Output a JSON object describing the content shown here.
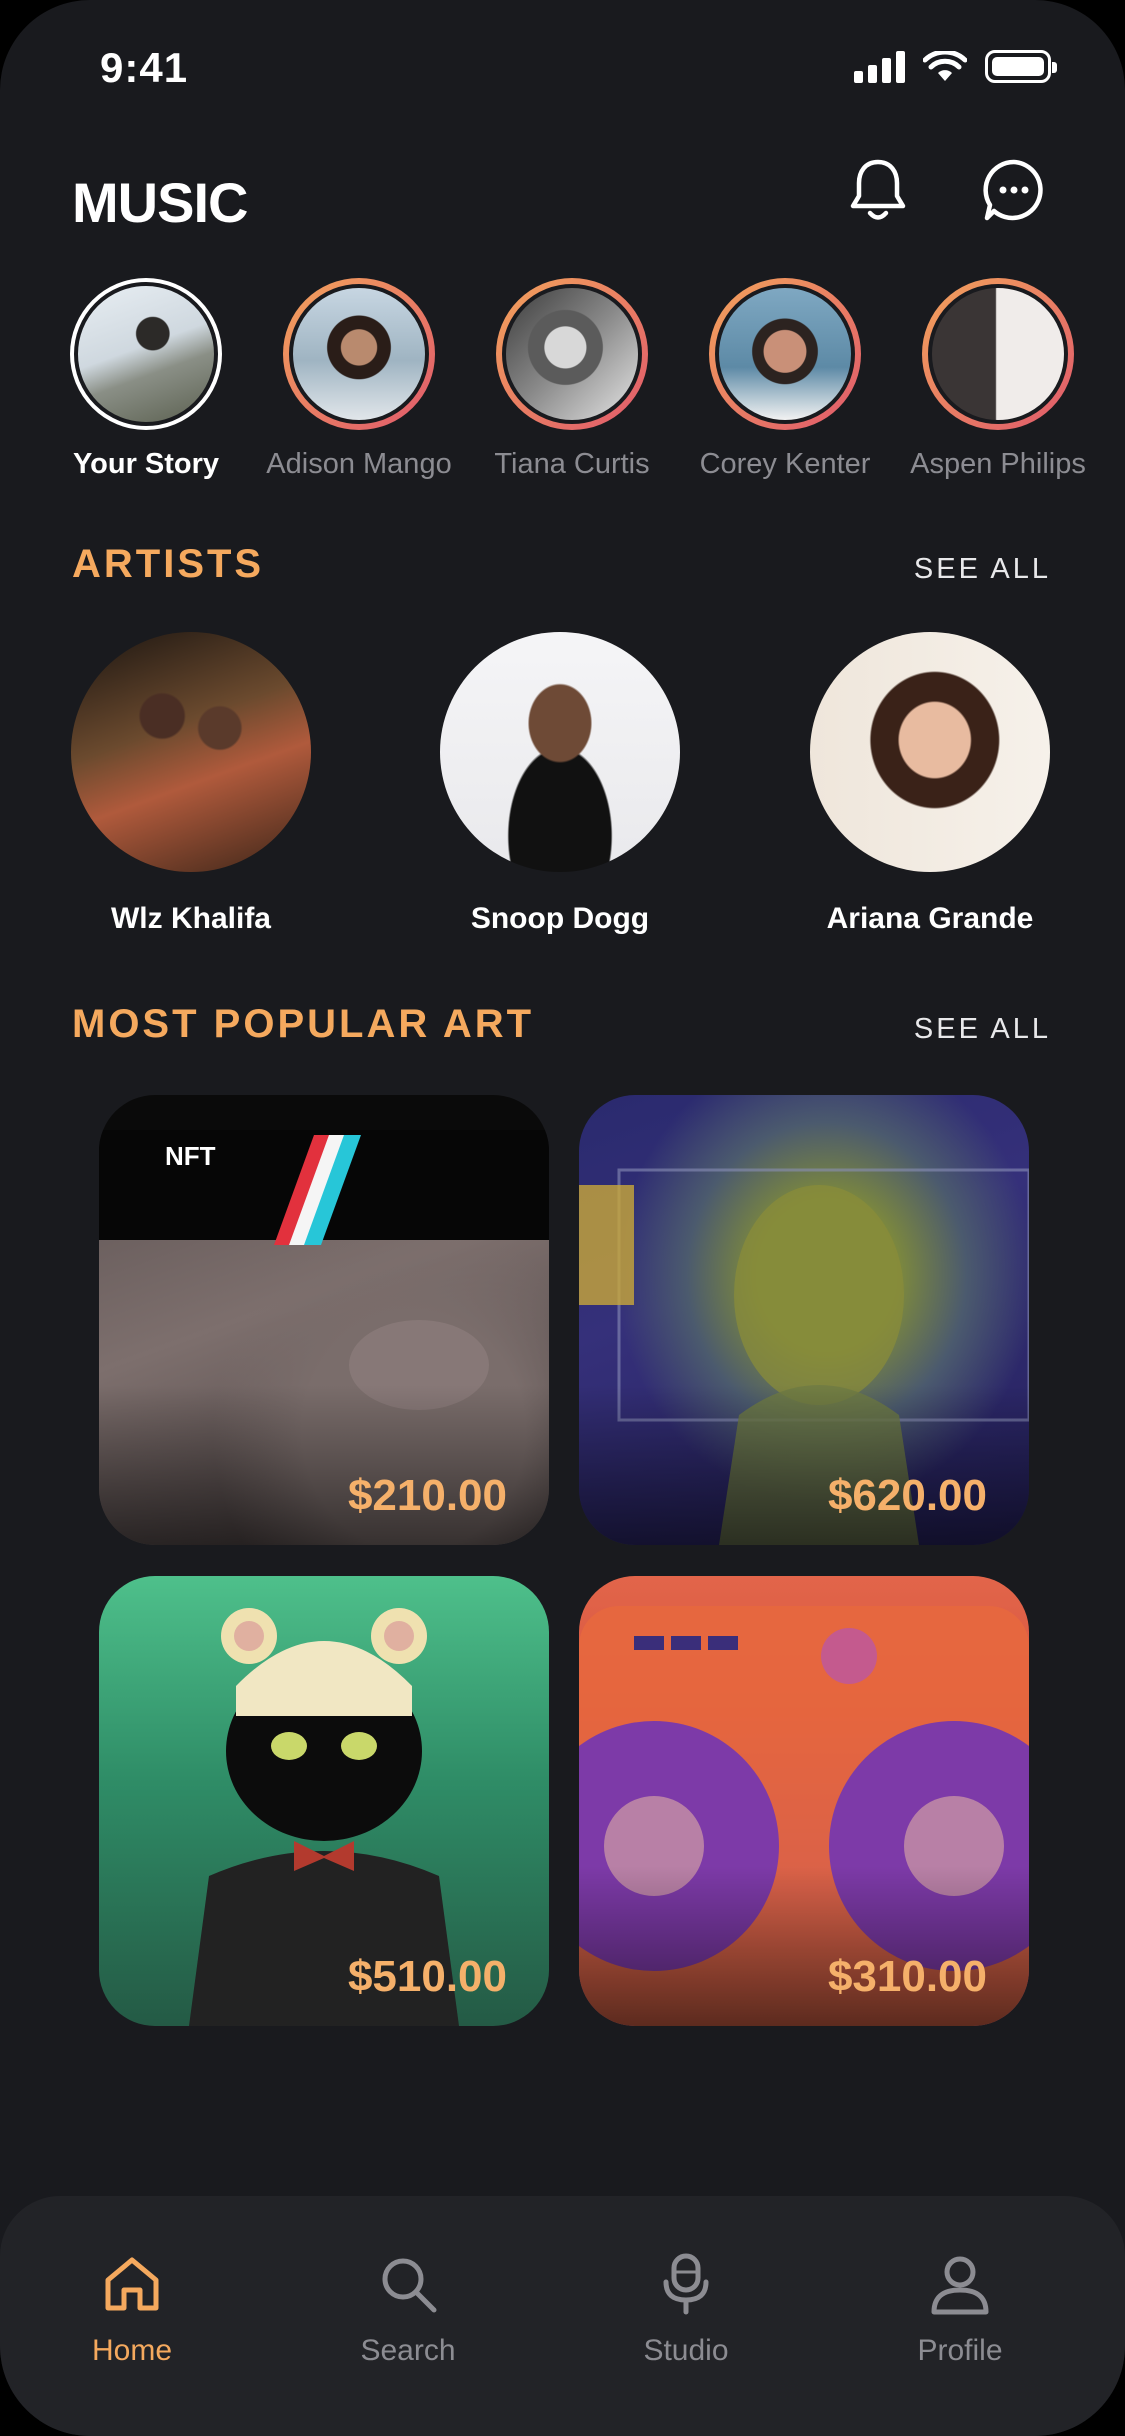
{
  "status_bar": {
    "time": "9:41"
  },
  "header": {
    "title": "MUSIC",
    "notification_icon": "bell-icon",
    "chat_icon": "chat-bubble-icon"
  },
  "stories": [
    {
      "name": "Your Story",
      "own": true
    },
    {
      "name": "Adison Mango",
      "own": false
    },
    {
      "name": "Tiana Curtis",
      "own": false
    },
    {
      "name": "Corey Kenter",
      "own": false
    },
    {
      "name": "Aspen Philips",
      "own": false
    }
  ],
  "artists_section": {
    "title": "ARTISTS",
    "see_all": "SEE ALL",
    "items": [
      {
        "name": "Wlz Khalifa"
      },
      {
        "name": "Snoop Dogg"
      },
      {
        "name": "Ariana Grande"
      }
    ]
  },
  "art_section": {
    "title": "MOST POPULAR ART",
    "see_all": "SEE ALL",
    "items": [
      {
        "price": "$210.00"
      },
      {
        "price": "$620.00"
      },
      {
        "price": "$510.00"
      },
      {
        "price": "$310.00"
      }
    ]
  },
  "bottom_nav": [
    {
      "label": "Home",
      "icon": "home-icon",
      "active": true
    },
    {
      "label": "Search",
      "icon": "search-icon",
      "active": false
    },
    {
      "label": "Studio",
      "icon": "microphone-icon",
      "active": false
    },
    {
      "label": "Profile",
      "icon": "user-icon",
      "active": false
    }
  ],
  "colors": {
    "background": "#191a1e",
    "accent": "#f5a95e",
    "price": "#f5b06a",
    "muted": "#8c8c92",
    "nav_bg": "#222327"
  }
}
